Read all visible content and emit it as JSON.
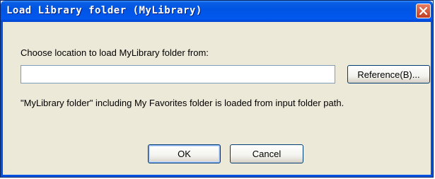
{
  "window": {
    "title": "Load Library folder (MyLibrary)",
    "close_icon": "close-icon"
  },
  "dialog": {
    "location_label": "Choose location to load MyLibrary folder from:",
    "path_value": "",
    "reference_button": "Reference(B)...",
    "info_text": "\"MyLibrary folder\" including My Favorites folder is loaded from input folder path.",
    "ok_button": "OK",
    "cancel_button": "Cancel"
  },
  "colors": {
    "titlebar": "#0054e3",
    "dialog_bg": "#ece9d8",
    "close_button": "#c13b20"
  }
}
